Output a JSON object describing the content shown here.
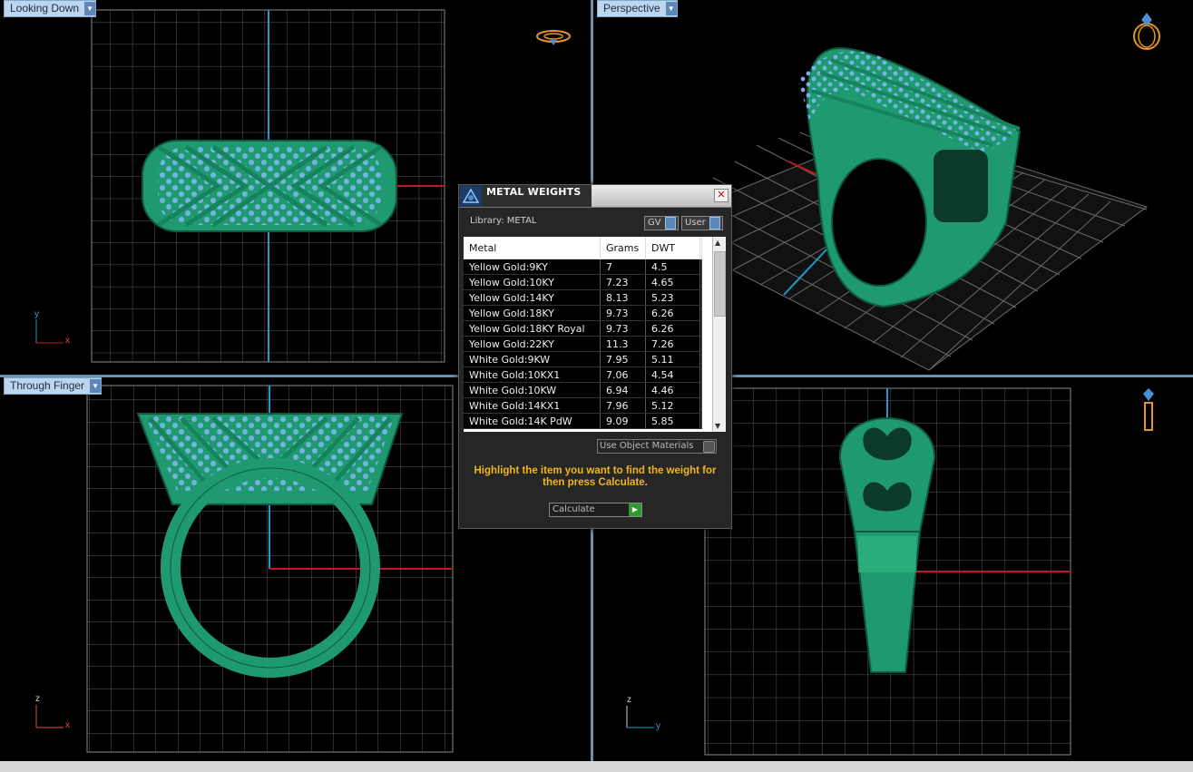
{
  "viewports": {
    "top_left": {
      "title": "Looking Down",
      "axis_a": "y",
      "axis_b": "x"
    },
    "top_right": {
      "title": "Perspective"
    },
    "bottom_left": {
      "title": "Through Finger",
      "axis_a": "z",
      "axis_b": "x"
    },
    "bottom_right": {
      "title": "",
      "axis_a": "z",
      "axis_b": "y"
    }
  },
  "dialog": {
    "title": "METAL WEIGHTS",
    "close_glyph": "✕",
    "library_label": "Library: METAL",
    "toggle_gv": "GV",
    "toggle_user": "User",
    "columns": [
      "Metal",
      "Grams",
      "DWT"
    ],
    "rows": [
      [
        "Yellow Gold:9KY",
        "7",
        "4.5"
      ],
      [
        "Yellow Gold:10KY",
        "7.23",
        "4.65"
      ],
      [
        "Yellow Gold:14KY",
        "8.13",
        "5.23"
      ],
      [
        "Yellow Gold:18KY",
        "9.73",
        "6.26"
      ],
      [
        "Yellow Gold:18KY Royal",
        "9.73",
        "6.26"
      ],
      [
        "Yellow Gold:22KY",
        "11.3",
        "7.26"
      ],
      [
        "White Gold:9KW",
        "7.95",
        "5.11"
      ],
      [
        "White Gold:10KX1",
        "7.06",
        "4.54"
      ],
      [
        "White Gold:10KW",
        "6.94",
        "4.46"
      ],
      [
        "White Gold:14KX1",
        "7.96",
        "5.12"
      ],
      [
        "White Gold:14K PdW",
        "9.09",
        "5.85"
      ]
    ],
    "use_object_materials": "Use Object Materials",
    "hint": "Highlight the item you want to find the weight for then press Calculate.",
    "calculate": "Calculate"
  },
  "colors": {
    "ring": "#1f9a70",
    "stone": "#7db6ec",
    "grid": "#5a5a5a",
    "accent": "#f0b51d",
    "viewport_title_bg": "#bcd6ee"
  }
}
